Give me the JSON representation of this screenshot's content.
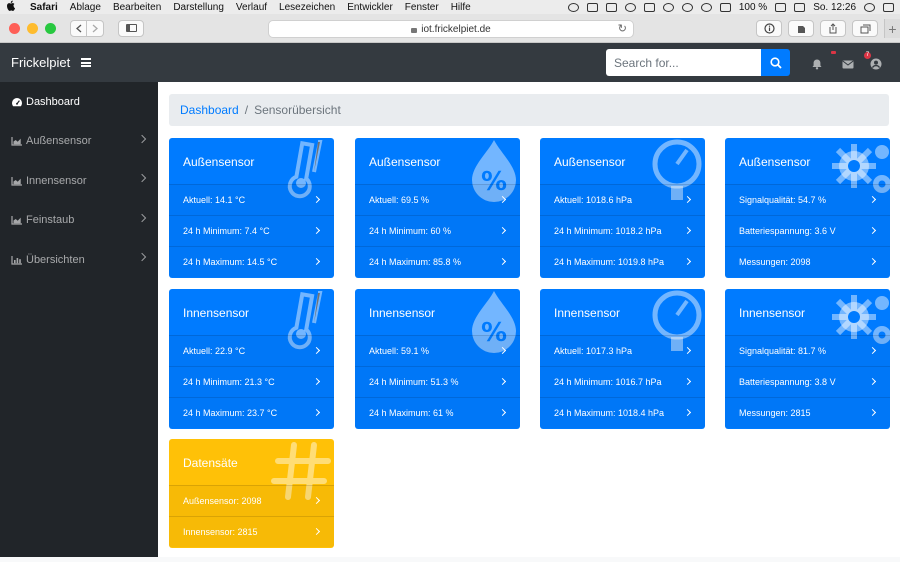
{
  "mac_menu": {
    "app_name": "Safari",
    "items": [
      "Ablage",
      "Bearbeiten",
      "Darstellung",
      "Verlauf",
      "Lesezeichen",
      "Entwickler",
      "Fenster",
      "Hilfe"
    ],
    "battery": "100 %",
    "clock": "So. 12:26"
  },
  "browser": {
    "url": "iot.frickelpiet.de"
  },
  "navbar": {
    "brand": "Frickelpiet",
    "search_placeholder": "Search for...",
    "alerts_badge": "",
    "messages_badge": "7"
  },
  "sidebar": {
    "items": [
      {
        "label": "Dashboard"
      },
      {
        "label": "Außensensor"
      },
      {
        "label": "Innensensor"
      },
      {
        "label": "Feinstaub"
      },
      {
        "label": "Übersichten"
      }
    ]
  },
  "breadcrumb": {
    "link": "Dashboard",
    "current": "Sensorübersicht"
  },
  "cards": [
    {
      "title": "Außensensor",
      "color": "#007bff",
      "icon": "thermometer-icon",
      "rows": [
        "Aktuell: 14.1 °C",
        "24 h Minimum: 7.4 °C",
        "24 h Maximum: 14.5 °C"
      ]
    },
    {
      "title": "Außensensor",
      "color": "#007bff",
      "icon": "humidity-drop-icon",
      "rows": [
        "Aktuell: 69.5 %",
        "24 h Minimum: 60 %",
        "24 h Maximum: 85.8 %"
      ]
    },
    {
      "title": "Außensensor",
      "color": "#007bff",
      "icon": "gauge-icon",
      "rows": [
        "Aktuell: 1018.6 hPa",
        "24 h Minimum: 1018.2 hPa",
        "24 h Maximum: 1019.8 hPa"
      ]
    },
    {
      "title": "Außensensor",
      "color": "#007bff",
      "icon": "cogs-icon",
      "rows": [
        "Signalqualität: 54.7 %",
        "Batteriespannung: 3.6 V",
        "Messungen: 2098"
      ]
    },
    {
      "title": "Innensensor",
      "color": "#007bff",
      "icon": "thermometer-icon",
      "rows": [
        "Aktuell: 22.9 °C",
        "24 h Minimum: 21.3 °C",
        "24 h Maximum: 23.7 °C"
      ]
    },
    {
      "title": "Innensensor",
      "color": "#007bff",
      "icon": "humidity-drop-icon",
      "rows": [
        "Aktuell: 59.1 %",
        "24 h Minimum: 51.3 %",
        "24 h Maximum: 61 %"
      ]
    },
    {
      "title": "Innensensor",
      "color": "#007bff",
      "icon": "gauge-icon",
      "rows": [
        "Aktuell: 1017.3 hPa",
        "24 h Minimum: 1016.7 hPa",
        "24 h Maximum: 1018.4 hPa"
      ]
    },
    {
      "title": "Innensensor",
      "color": "#007bff",
      "icon": "cogs-icon",
      "rows": [
        "Signalqualität: 81.7 %",
        "Batteriespannung: 3.8 V",
        "Messungen: 2815"
      ]
    },
    {
      "title": "Datensäte",
      "color": "#ffc107",
      "icon": "hashtag-icon",
      "rows": [
        "Außensensor: 2098",
        "Innensensor: 2815"
      ]
    }
  ]
}
